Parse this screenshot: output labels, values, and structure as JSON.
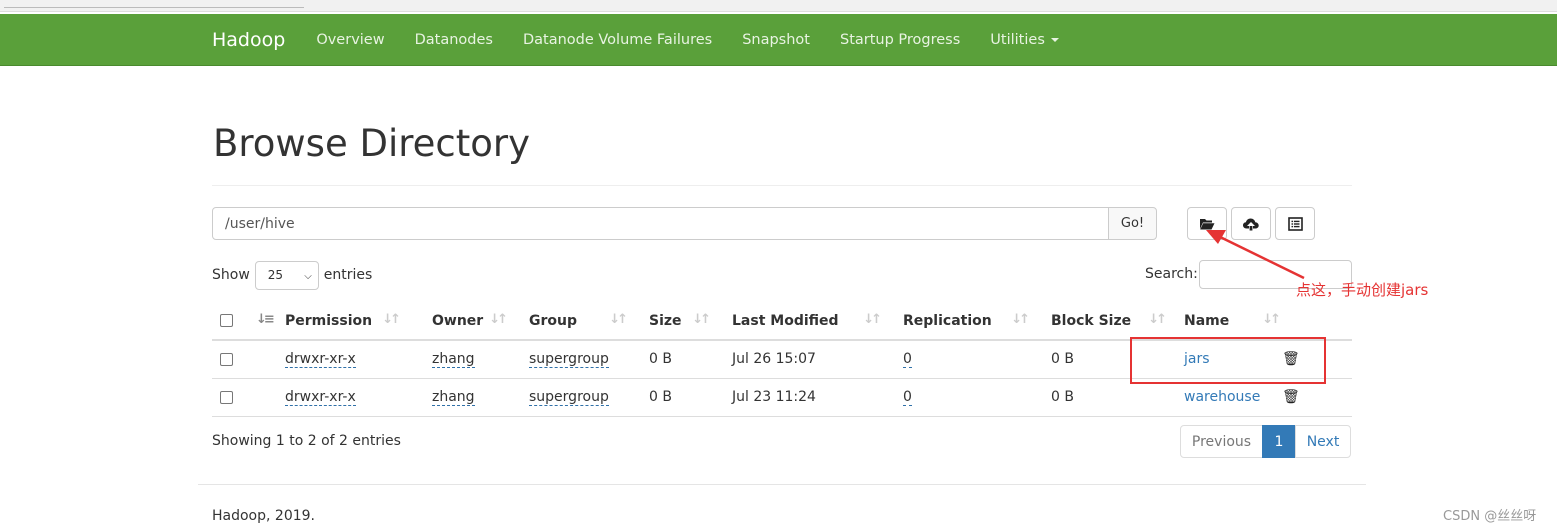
{
  "navbar": {
    "brand": "Hadoop",
    "items": [
      "Overview",
      "Datanodes",
      "Datanode Volume Failures",
      "Snapshot",
      "Startup Progress",
      "Utilities"
    ]
  },
  "page_title": "Browse Directory",
  "path_bar": {
    "value": "/user/hive",
    "go_label": "Go!"
  },
  "toolbar": {
    "icons": [
      "folder-open-icon",
      "cloud-upload-icon",
      "list-icon"
    ]
  },
  "length_control": {
    "show_label": "Show",
    "selected": "25",
    "entries_label": "entries"
  },
  "search": {
    "label": "Search:",
    "value": ""
  },
  "table": {
    "columns": [
      "Permission",
      "Owner",
      "Group",
      "Size",
      "Last Modified",
      "Replication",
      "Block Size",
      "Name"
    ],
    "rows": [
      {
        "permission": "drwxr-xr-x",
        "owner": "zhang",
        "group": "supergroup",
        "size": "0 B",
        "modified": "Jul 26 15:07",
        "replication": "0",
        "block_size": "0 B",
        "name": "jars"
      },
      {
        "permission": "drwxr-xr-x",
        "owner": "zhang",
        "group": "supergroup",
        "size": "0 B",
        "modified": "Jul 23 11:24",
        "replication": "0",
        "block_size": "0 B",
        "name": "warehouse"
      }
    ]
  },
  "info_text": "Showing 1 to 2 of 2 entries",
  "pagination": {
    "previous": "Previous",
    "current": "1",
    "next": "Next"
  },
  "footer": "Hadoop, 2019.",
  "annotation": {
    "text": "点这，手动创建jars",
    "color": "#e53333"
  },
  "watermark": "CSDN @丝丝呀",
  "colors": {
    "navbar": "#5aa03a",
    "link": "#337ab7",
    "annotation": "#e53333"
  }
}
